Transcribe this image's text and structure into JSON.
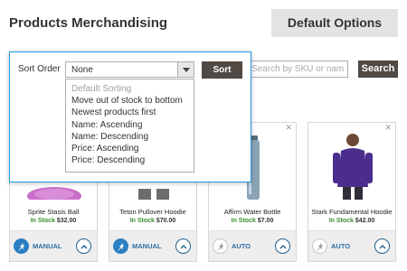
{
  "header": {
    "title": "Products Merchandising",
    "default_options_label": "Default Options"
  },
  "search": {
    "placeholder": "Search by SKU or name",
    "button_label": "Search"
  },
  "sort": {
    "label": "Sort Order",
    "selected": "None",
    "button_label": "Sort",
    "options": [
      "Default Sorting",
      "Move out of stock to bottom",
      "Newest products first",
      "Name: Ascending",
      "Name: Descending",
      "Price: Ascending",
      "Price: Descending"
    ]
  },
  "products": [
    {
      "name": "Sprite Stasis Ball",
      "stock": "In Stock",
      "price": "$32.00",
      "mode": "MANUAL"
    },
    {
      "name": "Teton Pullover Hoodie",
      "stock": "In Stock",
      "price": "$70.00",
      "mode": "MANUAL"
    },
    {
      "name": "Affirm Water Bottle",
      "stock": "In Stock",
      "price": "$7.00",
      "mode": "AUTO"
    },
    {
      "name": "Stark Fundamental Hoodie",
      "stock": "In Stock",
      "price": "$42.00",
      "mode": "AUTO"
    }
  ],
  "colors": {
    "accent_blue": "#2b7ec1",
    "dark_button": "#514943",
    "in_stock_green": "#3a8d2e",
    "popup_border": "#1e9be0"
  }
}
